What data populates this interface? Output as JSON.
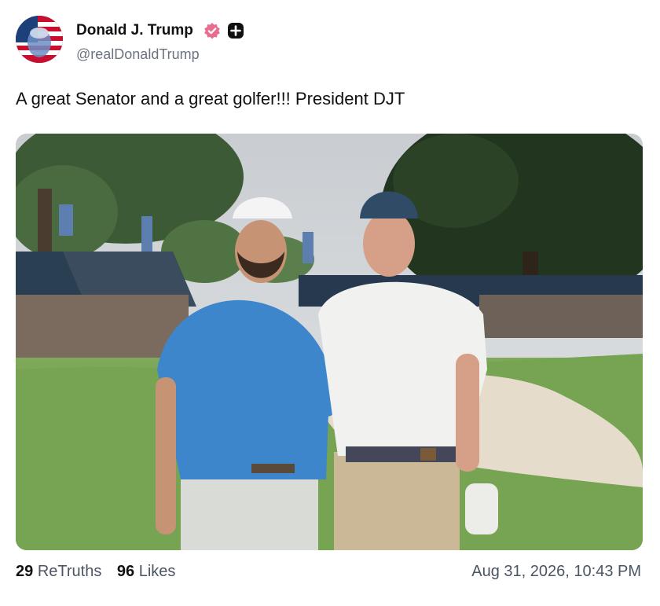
{
  "post": {
    "author_name": "Donald J. Trump",
    "author_handle": "@realDonaldTrump",
    "text": "A great Senator and a great golfer!!! President DJT",
    "retruths_count": "29",
    "retruths_label": "ReTruths",
    "likes_count": "96",
    "likes_label": "Likes",
    "timestamp": "Aug 31, 2026, 10:43 PM"
  },
  "icons": {
    "verified": "verified-badge-icon",
    "plus": "plus-badge-icon"
  },
  "colors": {
    "verified_badge": "#e76e8e",
    "plus_badge": "#111111",
    "muted_text": "#6b7280"
  }
}
